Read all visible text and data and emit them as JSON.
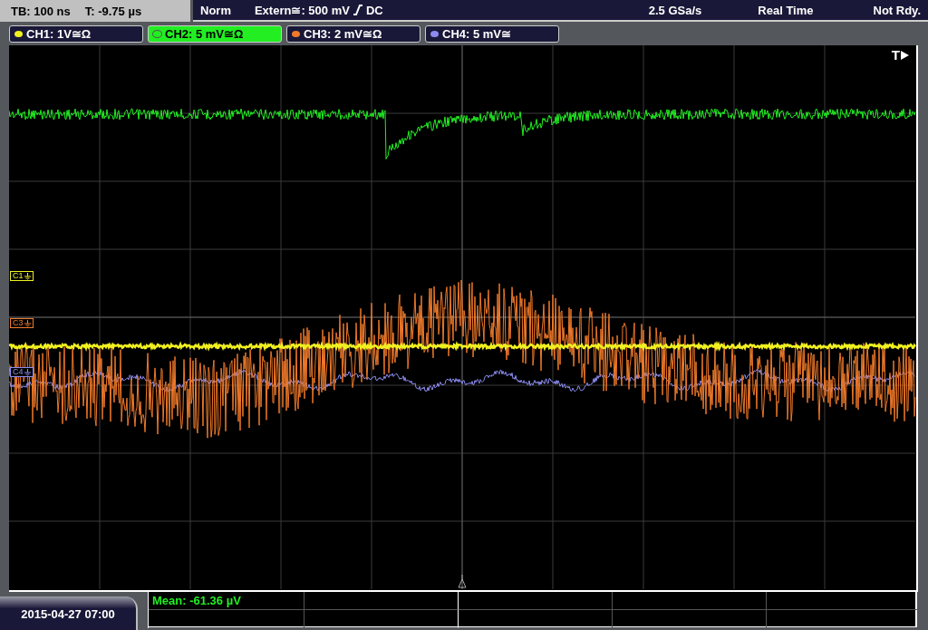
{
  "status_bar": {
    "timebase": "TB: 100 ns",
    "trigger_time": "T: -9.75 µs",
    "trigger_mode": "Norm",
    "trigger_source": "Extern≅: 500 mV",
    "trigger_coupling": "DC",
    "sample_rate": "2.5 GSa/s",
    "acquisition": "Real Time",
    "state": "Not Rdy."
  },
  "channels": [
    {
      "label": "CH1: 1V≅Ω",
      "color": "#f0f020",
      "selected": false,
      "marker": "C1"
    },
    {
      "label": "CH2: 5 mV≅Ω",
      "color": "#22ee22",
      "selected": true
    },
    {
      "label": "CH3: 2 mV≅Ω",
      "color": "#f07a2a",
      "selected": false,
      "marker": "C3"
    },
    {
      "label": "CH4: 5 mV≅",
      "color": "#8c8cf0",
      "selected": false,
      "marker": "C4"
    }
  ],
  "trigger_label": "T",
  "date": "2015-04-27 07:00",
  "measurements": [
    {
      "text": "Mean: -61.36 µV"
    }
  ]
}
